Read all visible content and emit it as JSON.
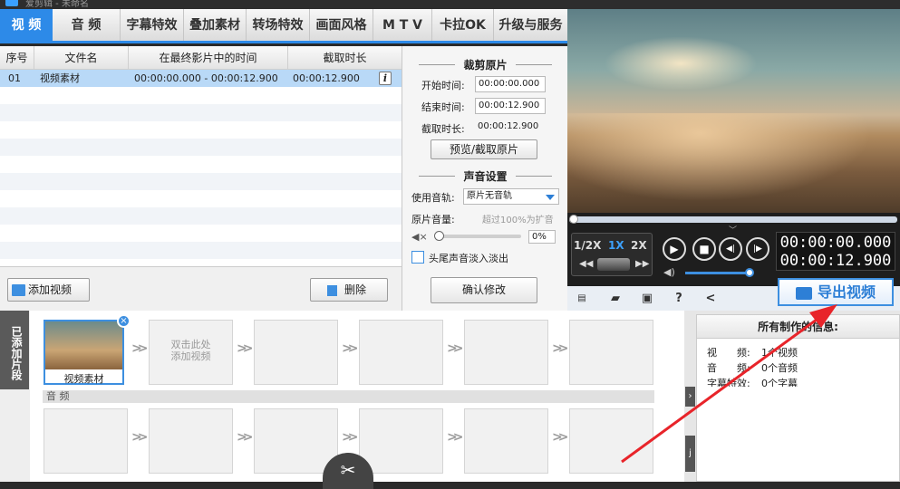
{
  "titlebar": {
    "title": "爱剪辑 - 未命名"
  },
  "tabs": [
    "视 频",
    "音 频",
    "字幕特效",
    "叠加素材",
    "转场特效",
    "画面风格",
    "M T V",
    "卡拉OK",
    "升级与服务"
  ],
  "table": {
    "headers": [
      "序号",
      "文件名",
      "在最终影片中的时间",
      "截取时长"
    ],
    "rows": [
      {
        "index": "01",
        "name": "视频素材",
        "range": "00:00:00.000 - 00:00:12.900",
        "duration": "00:00:12.900",
        "info": "i"
      }
    ]
  },
  "left_buttons": {
    "add": "添加视频",
    "delete": "删除"
  },
  "crop": {
    "title": "裁剪原片",
    "start_label": "开始时间:",
    "start_value": "00:00:00.000",
    "end_label": "结束时间:",
    "end_value": "00:00:12.900",
    "dur_label": "截取时长:",
    "dur_value": "00:00:12.900",
    "preview_btn": "预览/截取原片"
  },
  "sound": {
    "title": "声音设置",
    "track_label": "使用音轨:",
    "track_value": "原片无音轨",
    "volume_label": "原片音量:",
    "volume_hint": "超过100%为扩音",
    "volume_value": "0%",
    "fade_label": "头尾声音淡入淡出",
    "confirm_btn": "确认修改"
  },
  "player": {
    "speeds": [
      "1/2X",
      "1X",
      "2X"
    ],
    "time_current": "00:00:00.000",
    "time_total": "00:00:12.900",
    "export_btn": "导出视频"
  },
  "timeline": {
    "side_label": "已添加片段",
    "clip_name": "视频素材",
    "empty_hint": "双击此处添加视频",
    "audio_label": "音 频"
  },
  "info": {
    "title": "所有制作的信息:",
    "lines": [
      {
        "k": "视　　频:",
        "v": "1个视频"
      },
      {
        "k": "音　　频:",
        "v": "0个音频"
      },
      {
        "k": "字幕特效:",
        "v": "0个字幕"
      }
    ]
  },
  "colors": {
    "accent": "#2d8ae8",
    "annotation": "#e8242a"
  }
}
